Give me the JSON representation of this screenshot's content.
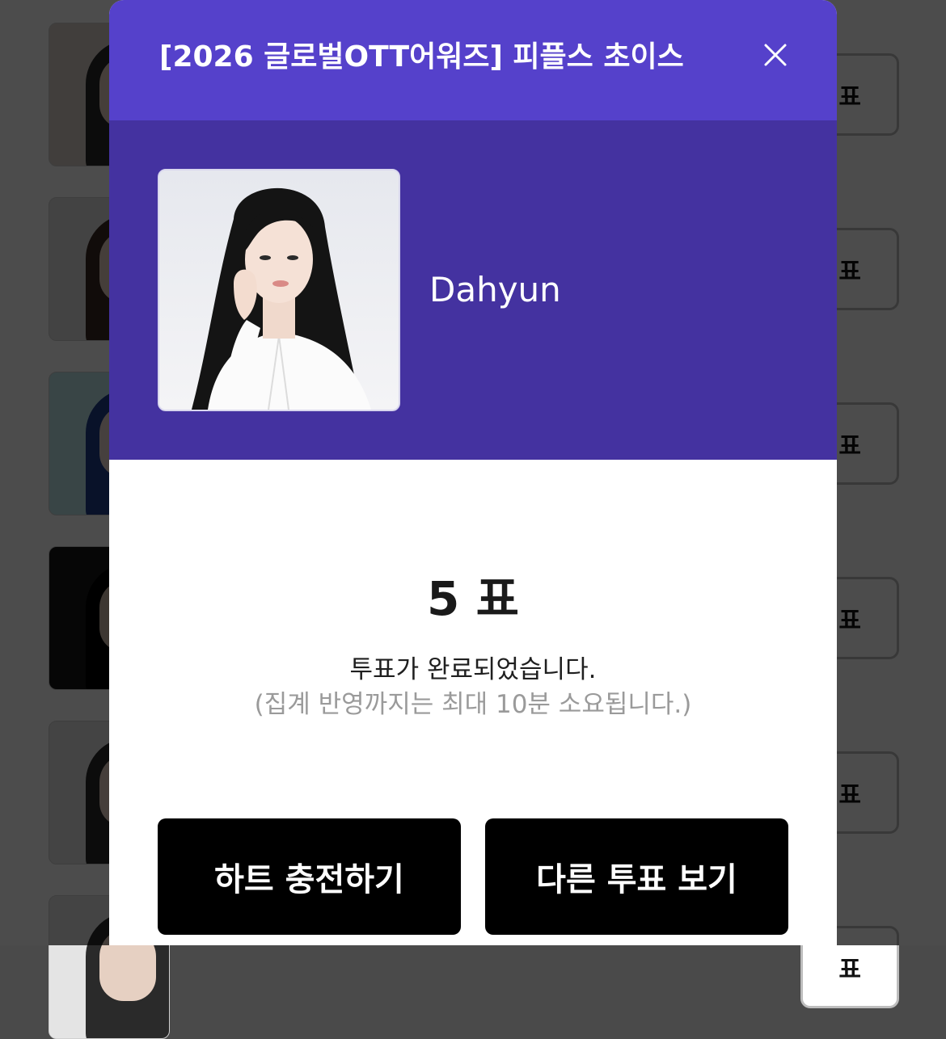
{
  "background": {
    "vote_button_label": "표",
    "rows": 6
  },
  "modal": {
    "title": "[2026 글로벌OTT어워즈] 피플스 초이스",
    "close_icon": "close-icon",
    "profile": {
      "name": "Dahyun"
    },
    "result": {
      "vote_count": "5 표",
      "message": "투표가 완료되었습니다.",
      "sub_message": "(집계 반영까지는 최대 10분 소요됩니다.)"
    },
    "buttons": {
      "charge_label": "하트 충전하기",
      "other_votes_label": "다른 투표 보기"
    }
  },
  "colors": {
    "header": "#5541cb",
    "profile_band": "#4432a0",
    "button": "#000000"
  }
}
